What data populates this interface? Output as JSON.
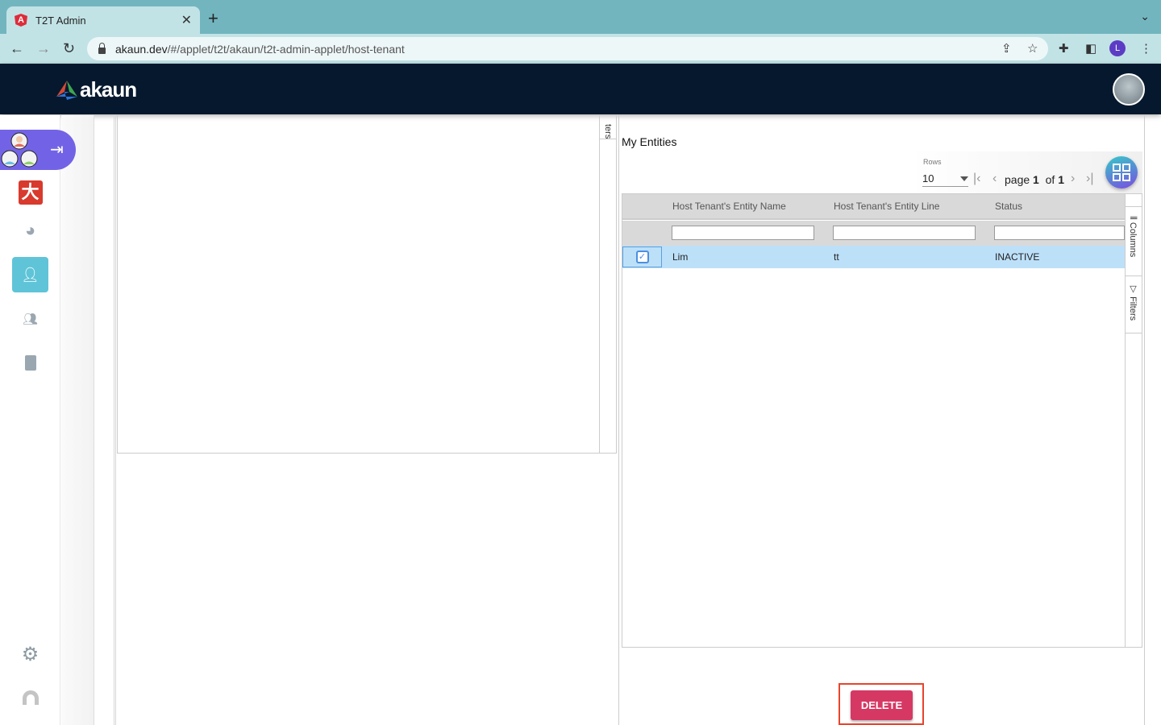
{
  "browser": {
    "tab_title": "T2T Admin",
    "url_host": "akaun.dev",
    "url_path": "/#/applet/t2t/akaun/t2t-admin-applet/host-tenant",
    "profile_initial": "L"
  },
  "app": {
    "logo_text": "akaun"
  },
  "left_panel": {
    "side_tab": "ters"
  },
  "entities": {
    "title": "My Entities",
    "rows_label": "Rows",
    "rows_value": "10",
    "page_word": "page",
    "page_current": "1",
    "of_word": "of",
    "page_total": "1",
    "columns": [
      "Host Tenant's Entity Name",
      "Host Tenant's Entity Line",
      "Status"
    ],
    "rows": [
      {
        "name": "Lim",
        "line": "tt",
        "status": "INACTIVE",
        "selected": true
      }
    ],
    "side_tabs": {
      "columns": "Columns",
      "filters": "Filters"
    }
  },
  "actions": {
    "delete_label": "DELETE"
  },
  "colors": {
    "header": "#06182e",
    "accent": "#5fc4d8",
    "delete": "#d63864",
    "selected_row": "#bde0f9"
  }
}
